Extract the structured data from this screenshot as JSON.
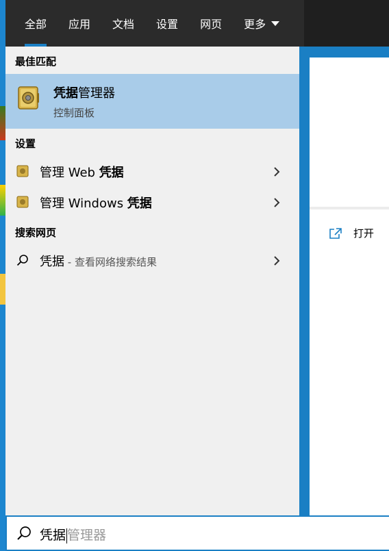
{
  "tabs": [
    {
      "label": "全部",
      "active": true
    },
    {
      "label": "应用"
    },
    {
      "label": "文档"
    },
    {
      "label": "设置"
    },
    {
      "label": "网页"
    },
    {
      "label": "更多",
      "has_dropdown": true
    }
  ],
  "best_match": {
    "section_title": "最佳匹配",
    "name_bold": "凭据",
    "name_rest": "管理器",
    "subtitle": "控制面板",
    "icon": "credential-manager-icon"
  },
  "settings": {
    "section_title": "设置",
    "items": [
      {
        "label_prefix": "管理 Web ",
        "label_bold": "凭据",
        "icon": "credential-settings-icon"
      },
      {
        "label_prefix": "管理 Windows ",
        "label_bold": "凭据",
        "icon": "credential-settings-icon"
      }
    ]
  },
  "web_search": {
    "section_title": "搜索网页",
    "query": "凭据",
    "hint": " - 查看网络搜索结果",
    "icon": "search-icon"
  },
  "preview": {
    "open_label": "打开",
    "open_icon": "open-external-icon"
  },
  "search": {
    "typed_text": "凭据",
    "suggestion_text": "管理器",
    "icon": "search-icon"
  },
  "colors": {
    "accent": "#1a7fc4",
    "topbar": "#2b2b2b",
    "panel": "#f0f0f0",
    "selected": "#a9cce9"
  }
}
